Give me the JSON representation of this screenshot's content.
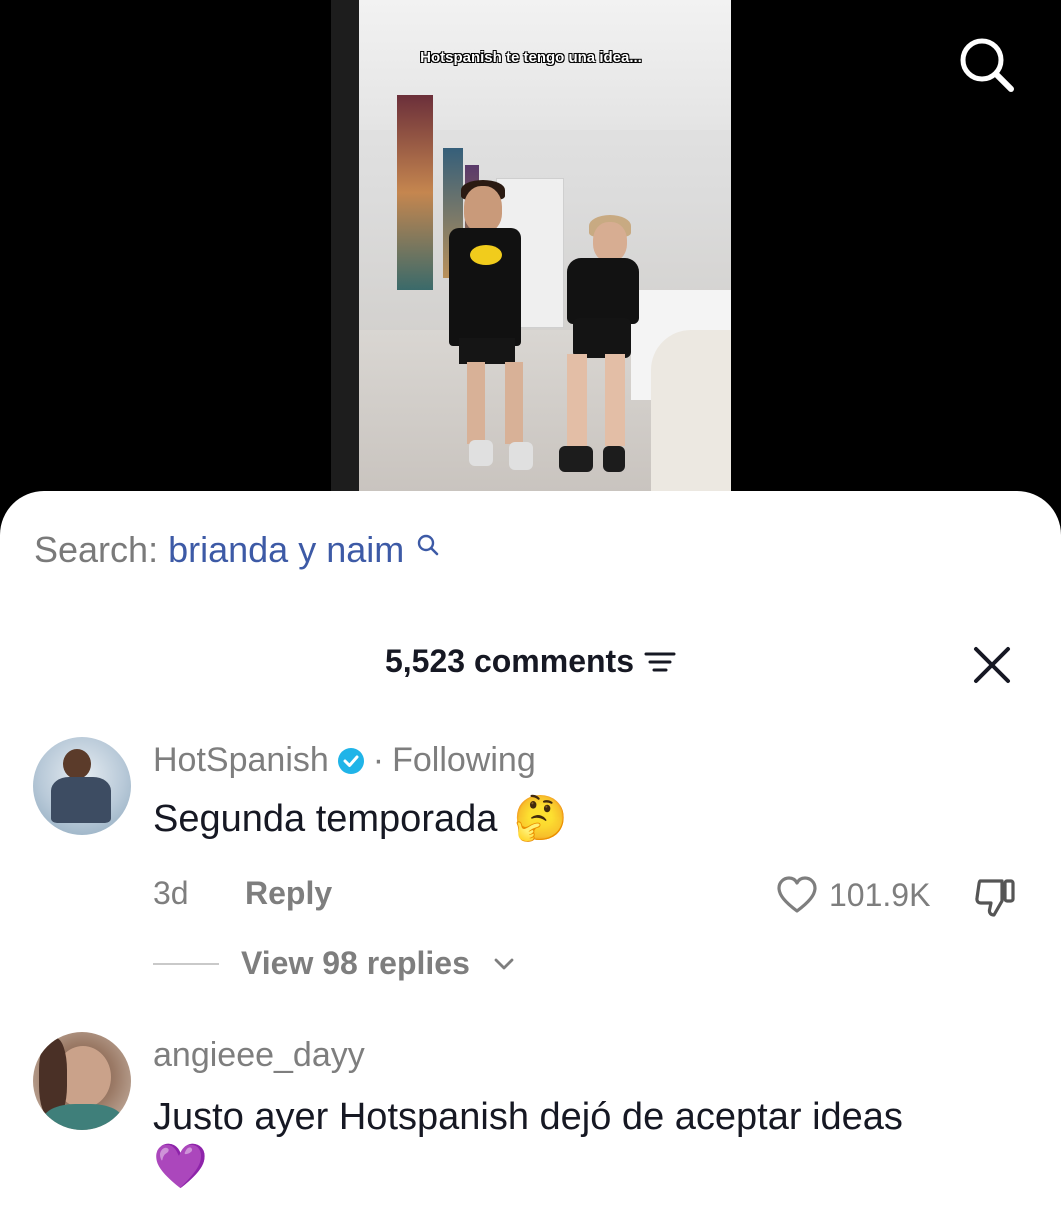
{
  "video": {
    "caption": "Hotspanish te tengo una idea..."
  },
  "top_icons": [
    "search-icon"
  ],
  "search": {
    "prefix": "Search:",
    "query": "brianda y naim"
  },
  "comments_header": {
    "count_label": "5,523 comments"
  },
  "comments": [
    {
      "username": "HotSpanish",
      "verified": true,
      "separator": "·",
      "relation": "Following",
      "text": "Segunda temporada",
      "emoji": "🤔",
      "time": "3d",
      "reply_label": "Reply",
      "likes": "101.9K",
      "view_replies_label": "View 98 replies"
    },
    {
      "username": "angieee_dayy",
      "text": "Justo ayer Hotspanish dejó de aceptar ideas",
      "emoji": "💜"
    }
  ],
  "colors": {
    "link_blue": "#3d5aa6",
    "verified_blue": "#20b4e8",
    "text_gray": "#7e7e7e",
    "text_dark": "#161823"
  }
}
